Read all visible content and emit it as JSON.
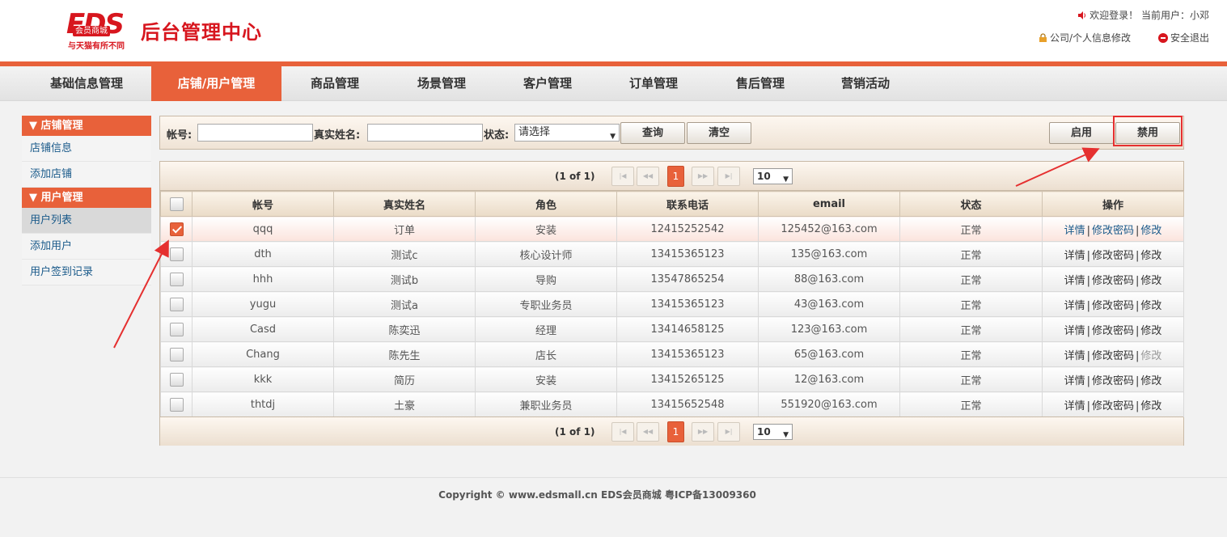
{
  "header": {
    "logo_text": "EDS",
    "logo_mall": "会员商城",
    "logo_slogan": "与天猫有所不同",
    "site_title": "后台管理中心",
    "welcome": "欢迎登录！ 当前用户：小邓",
    "company_info_link": "公司/个人信息修改",
    "logout_link": "安全退出"
  },
  "nav": {
    "items": [
      {
        "label": "基础信息管理"
      },
      {
        "label": "店铺/用户管理"
      },
      {
        "label": "商品管理"
      },
      {
        "label": "场景管理"
      },
      {
        "label": "客户管理"
      },
      {
        "label": "订单管理"
      },
      {
        "label": "售后管理"
      },
      {
        "label": "营销活动"
      }
    ],
    "active_index": 1
  },
  "sidebar": {
    "groups": [
      {
        "title": "▼ 店铺管理",
        "items": [
          "店铺信息",
          "添加店铺"
        ]
      },
      {
        "title": "▼ 用户管理",
        "items": [
          "用户列表",
          "添加用户",
          "用户签到记录"
        ]
      }
    ]
  },
  "search": {
    "account_label": "帐号:",
    "account_value": "",
    "realname_label": "真实姓名:",
    "realname_value": "",
    "status_label": "状态:",
    "status_selected": "请选择",
    "query_button": "查询",
    "clear_button": "清空",
    "enable_button": "启用",
    "disable_button": "禁用"
  },
  "pager": {
    "info": "(1 of 1)",
    "current_page": "1",
    "page_size": "10"
  },
  "table": {
    "columns": [
      "帐号",
      "真实姓名",
      "角色",
      "联系电话",
      "email",
      "状态",
      "操作"
    ],
    "rows": [
      {
        "account": "qqq",
        "name": "订单",
        "role": "安装",
        "phone": "12415252542",
        "email": "125452@163.com",
        "status": "正常",
        "checked": true
      },
      {
        "account": "dth",
        "name": "测试c",
        "role": "核心设计师",
        "phone": "13415365123",
        "email": "135@163.com",
        "status": "正常",
        "checked": false
      },
      {
        "account": "hhh",
        "name": "测试b",
        "role": "导购",
        "phone": "13547865254",
        "email": "88@163.com",
        "status": "正常",
        "checked": false
      },
      {
        "account": "yugu",
        "name": "测试a",
        "role": "专职业务员",
        "phone": "13415365123",
        "email": "43@163.com",
        "status": "正常",
        "checked": false
      },
      {
        "account": "Casd",
        "name": "陈奕迅",
        "role": "经理",
        "phone": "13414658125",
        "email": "123@163.com",
        "status": "正常",
        "checked": false
      },
      {
        "account": "Chang",
        "name": "陈先生",
        "role": "店长",
        "phone": "13415365123",
        "email": "65@163.com",
        "status": "正常",
        "checked": false
      },
      {
        "account": "kkk",
        "name": "简历",
        "role": "安装",
        "phone": "13415265125",
        "email": "12@163.com",
        "status": "正常",
        "checked": false
      },
      {
        "account": "thtdj",
        "name": "土豪",
        "role": "兼职业务员",
        "phone": "13415652548",
        "email": "551920@163.com",
        "status": "正常",
        "checked": false
      }
    ],
    "op_detail": "详情",
    "op_sep": "|",
    "op_password": "修改密码",
    "op_edit": "修改"
  },
  "footer": {
    "copyright": "Copyright © www.edsmall.cn EDS会员商城 粤ICP备13009360"
  },
  "colors": {
    "accent": "#e8613a",
    "brand_red": "#d7161e",
    "link": "#1a5a8a",
    "annotation_red": "#e53030"
  }
}
